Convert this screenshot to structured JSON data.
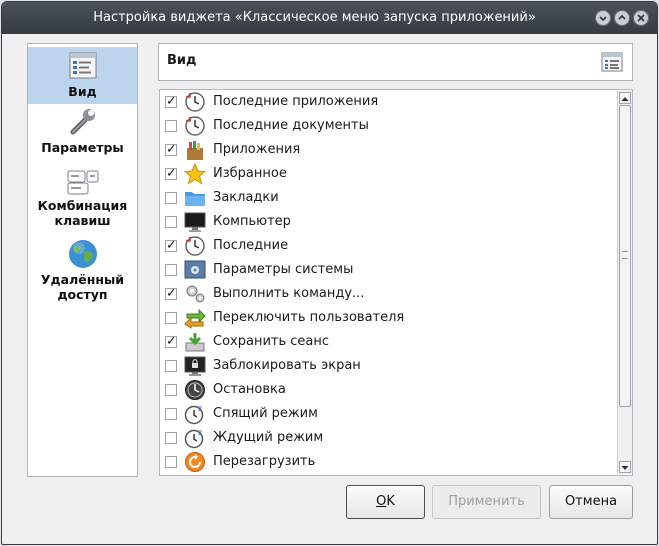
{
  "window": {
    "title": "Настройка виджета «Классическое меню запуска приложений»",
    "controls": [
      "minimize-icon",
      "maximize-icon",
      "close-icon"
    ]
  },
  "sidebar": {
    "items": [
      {
        "label": "Вид",
        "icon": "view-settings-icon",
        "active": true
      },
      {
        "label": "Параметры",
        "icon": "wrench-icon",
        "active": false
      },
      {
        "label": "Комбинация клавиш",
        "icon": "keyboard-shortcut-icon",
        "active": false
      },
      {
        "label": "Удалённый доступ",
        "icon": "globe-icon",
        "active": false
      }
    ]
  },
  "header": {
    "title": "Вид",
    "icon": "view-settings-icon"
  },
  "items": [
    {
      "label": "Последние приложения",
      "checked": true,
      "icon": "recent-apps-icon"
    },
    {
      "label": "Последние документы",
      "checked": false,
      "icon": "recent-documents-icon"
    },
    {
      "label": "Приложения",
      "checked": true,
      "icon": "applications-icon"
    },
    {
      "label": "Избранное",
      "checked": true,
      "icon": "star-icon"
    },
    {
      "label": "Закладки",
      "checked": false,
      "icon": "folder-icon"
    },
    {
      "label": "Компьютер",
      "checked": false,
      "icon": "monitor-icon"
    },
    {
      "label": "Последние",
      "checked": true,
      "icon": "recent-icon"
    },
    {
      "label": "Параметры системы",
      "checked": false,
      "icon": "system-settings-icon"
    },
    {
      "label": "Выполнить команду...",
      "checked": true,
      "icon": "run-command-icon"
    },
    {
      "label": "Переключить пользователя",
      "checked": false,
      "icon": "switch-user-icon"
    },
    {
      "label": "Сохранить сеанс",
      "checked": true,
      "icon": "save-session-icon"
    },
    {
      "label": "Заблокировать экран",
      "checked": false,
      "icon": "lock-screen-icon"
    },
    {
      "label": "Остановка",
      "checked": false,
      "icon": "shutdown-icon"
    },
    {
      "label": "Спящий режим",
      "checked": false,
      "icon": "sleep-icon"
    },
    {
      "label": "Ждущий режим",
      "checked": false,
      "icon": "suspend-icon"
    },
    {
      "label": "Перезагрузить",
      "checked": false,
      "icon": "reboot-icon"
    }
  ],
  "buttons": {
    "ok": {
      "mnemonic": "O",
      "rest": "K"
    },
    "apply": "Применить",
    "cancel": "Отмена"
  }
}
